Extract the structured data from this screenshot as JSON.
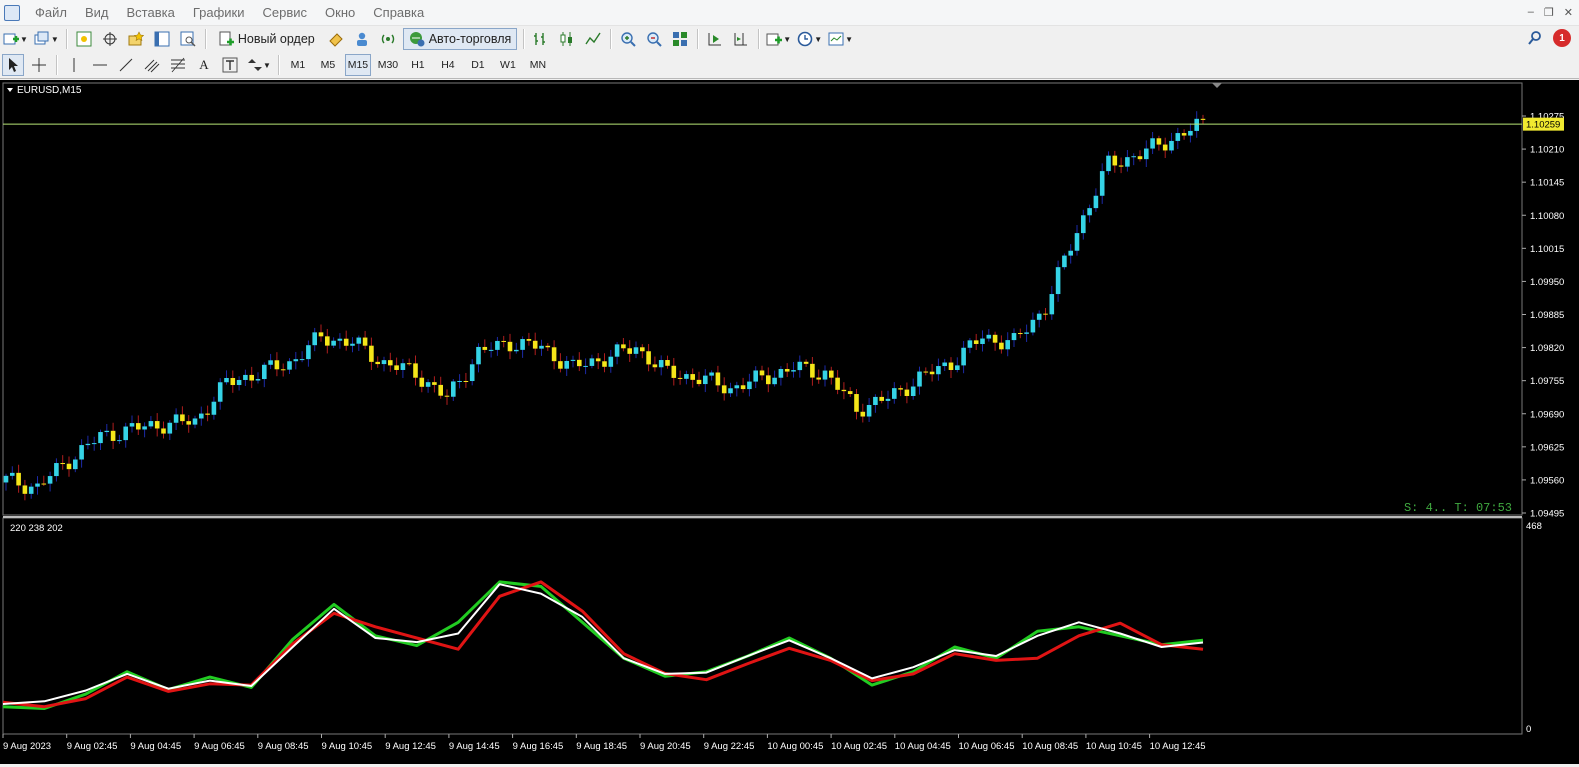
{
  "menu": [
    "Файл",
    "Вид",
    "Вставка",
    "Графики",
    "Сервис",
    "Окно",
    "Справка"
  ],
  "toolbar": {
    "new_order_label": "Новый ордер",
    "auto_trading_label": "Авто-торговля",
    "notification_count": "1"
  },
  "timeframes": [
    "M1",
    "M5",
    "M15",
    "M30",
    "H1",
    "H4",
    "D1",
    "W1",
    "MN"
  ],
  "active_timeframe": "M15",
  "chart": {
    "symbol_label": "EURUSD,M15",
    "current_price_label": "1.10259",
    "countdown_text": "S: 4.. T: 07:53",
    "price_ticks": [
      "1.10275",
      "1.10210",
      "1.10145",
      "1.10080",
      "1.10015",
      "1.09950",
      "1.09885",
      "1.09820",
      "1.09755",
      "1.09690",
      "1.09625",
      "1.09560",
      "1.09495"
    ],
    "time_ticks": [
      "9 Aug 2023",
      "9 Aug 02:45",
      "9 Aug 04:45",
      "9 Aug 06:45",
      "9 Aug 08:45",
      "9 Aug 10:45",
      "9 Aug 12:45",
      "9 Aug 14:45",
      "9 Aug 16:45",
      "9 Aug 18:45",
      "9 Aug 20:45",
      "9 Aug 22:45",
      "10 Aug 00:45",
      "10 Aug 02:45",
      "10 Aug 04:45",
      "10 Aug 06:45",
      "10 Aug 08:45",
      "10 Aug 10:45",
      "10 Aug 12:45"
    ],
    "indicator_label": "220 238 202",
    "indicator_scale_top": "468",
    "indicator_scale_bottom": "0",
    "colors": {
      "background": "#000000",
      "bull_candle": "#35d3e6",
      "bear_candle": "#f5e619",
      "bull_wick": "#1c2aa8",
      "bear_wick": "#b01e1e",
      "price_line": "#b8e676",
      "green_line": "#22cc22",
      "white_line": "#ffffff",
      "red_line": "#e01414",
      "countdown": "#3fa83f"
    }
  },
  "chart_data": {
    "type": "candlestick",
    "symbol": "EURUSD",
    "timeframe": "M15",
    "price_range": [
      1.09495,
      1.1029
    ],
    "close_anchors": [
      [
        0,
        1.0956
      ],
      [
        5,
        1.09545
      ],
      [
        10,
        1.096
      ],
      [
        15,
        1.09645
      ],
      [
        20,
        1.0966
      ],
      [
        25,
        1.0967
      ],
      [
        30,
        1.09675
      ],
      [
        35,
        1.0975
      ],
      [
        40,
        1.0977
      ],
      [
        45,
        1.0979
      ],
      [
        50,
        1.0984
      ],
      [
        55,
        1.0983
      ],
      [
        60,
        1.0979
      ],
      [
        65,
        1.0977
      ],
      [
        70,
        1.0972
      ],
      [
        75,
        1.0981
      ],
      [
        80,
        1.0983
      ],
      [
        85,
        1.0982
      ],
      [
        90,
        1.0978
      ],
      [
        95,
        1.098
      ],
      [
        100,
        1.0982
      ],
      [
        105,
        1.0977
      ],
      [
        110,
        1.0976
      ],
      [
        115,
        1.0974
      ],
      [
        120,
        1.0976
      ],
      [
        125,
        1.0978
      ],
      [
        130,
        1.0977
      ],
      [
        135,
        1.097
      ],
      [
        140,
        1.0972
      ],
      [
        145,
        1.0976
      ],
      [
        150,
        1.0979
      ],
      [
        155,
        1.0984
      ],
      [
        160,
        1.0983
      ],
      [
        165,
        1.099
      ],
      [
        170,
        1.1005
      ],
      [
        175,
        1.1018
      ],
      [
        180,
        1.102
      ],
      [
        185,
        1.1023
      ],
      [
        190,
        1.10259
      ]
    ],
    "indicator_range": [
      0,
      468
    ],
    "indicator_series": [
      {
        "name": "220",
        "values": [
          52,
          48,
          80,
          130,
          90,
          118,
          95,
          202,
          280,
          210,
          188,
          240,
          330,
          320,
          240,
          160,
          120,
          130,
          165,
          205,
          160,
          100,
          130,
          185,
          160,
          220,
          230,
          210,
          190,
          200
        ]
      },
      {
        "name": "238",
        "values": [
          58,
          64,
          88,
          125,
          92,
          110,
          98,
          185,
          270,
          205,
          196,
          215,
          325,
          304,
          252,
          160,
          125,
          128,
          165,
          200,
          160,
          115,
          140,
          178,
          165,
          210,
          240,
          215,
          185,
          195
        ]
      },
      {
        "name": "202",
        "values": [
          62,
          52,
          70,
          118,
          86,
          103,
          100,
          192,
          260,
          230,
          205,
          180,
          298,
          330,
          265,
          170,
          126,
          112,
          148,
          182,
          155,
          110,
          125,
          170,
          155,
          160,
          210,
          238,
          190,
          180
        ]
      }
    ]
  }
}
